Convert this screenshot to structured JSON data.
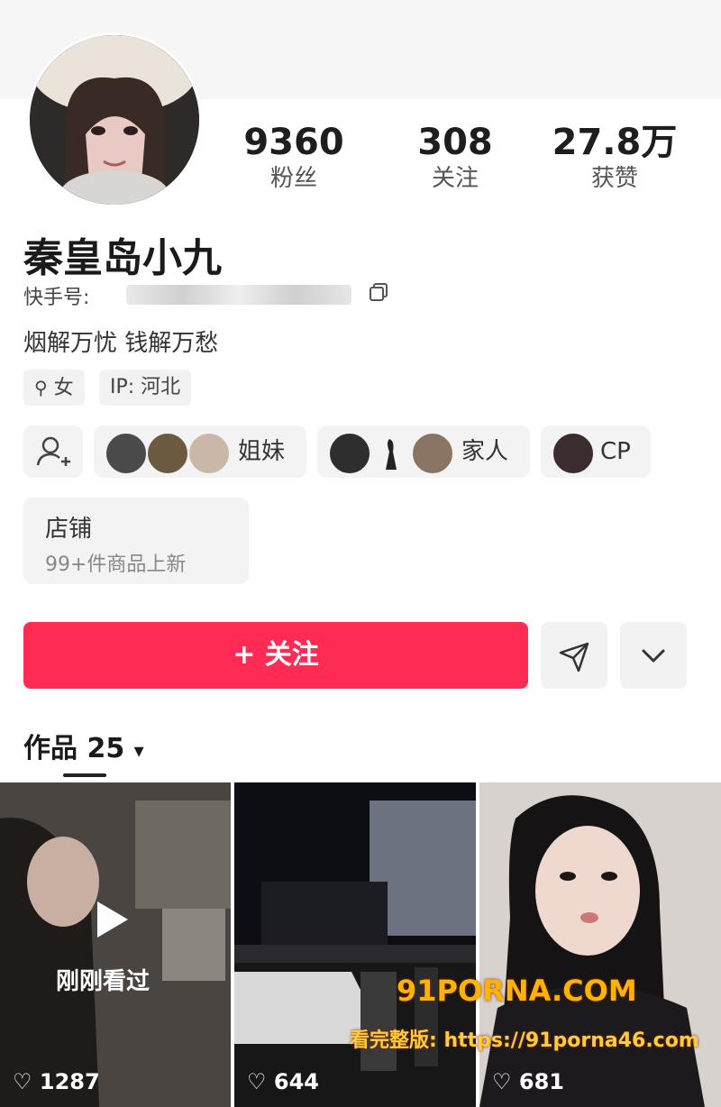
{
  "profile": {
    "name": "秦皇岛小九",
    "kuaishou_label": "快手号:",
    "bio": "烟解万忧 钱解万愁",
    "gender_tag": "女",
    "ip_tag": "IP: 河北"
  },
  "stats": [
    {
      "value": "9360",
      "label": "粉丝"
    },
    {
      "value": "308",
      "label": "关注"
    },
    {
      "value": "27.8万",
      "label": "获赞"
    }
  ],
  "groups": [
    {
      "label": "姐妹"
    },
    {
      "label": "家人"
    },
    {
      "label": "CP"
    }
  ],
  "shop": {
    "title": "店铺",
    "subtitle": "99+件商品上新"
  },
  "actions": {
    "follow_label": "+ 关注"
  },
  "works": {
    "label": "作品 25",
    "caret": "▾"
  },
  "videos": [
    {
      "overlay": "刚刚看过",
      "likes": "1287"
    },
    {
      "likes": "644"
    },
    {
      "likes": "681"
    }
  ],
  "watermark": {
    "line1": "91PORNA.COM",
    "line2": "看完整版: https://91porna46.com"
  },
  "colors": {
    "accent": "#fe2c55"
  }
}
